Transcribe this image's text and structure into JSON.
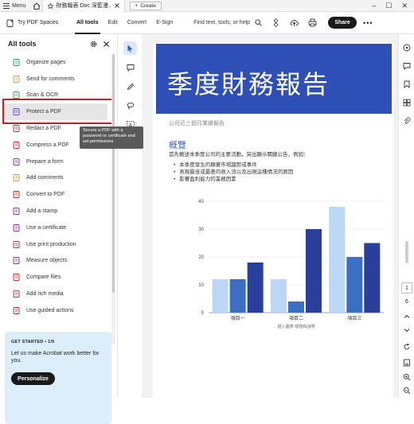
{
  "tabbar": {
    "menu_label": "Menu",
    "tab_title": "財務報表 Doc 深藍漫...",
    "create_label": "Create"
  },
  "toolbar": {
    "app_label": "Try PDF Spaces",
    "tabs": [
      {
        "label": "All tools",
        "active": true
      },
      {
        "label": "Edit"
      },
      {
        "label": "Convert"
      },
      {
        "label": "E-Sign"
      }
    ],
    "search_label": "Find text, tools, or help",
    "share_label": "Share"
  },
  "left_panel": {
    "title": "All tools",
    "tools": [
      {
        "label": "Organize pages",
        "icon": "organize-pages-icon",
        "color": "#38a169"
      },
      {
        "label": "Send for comments",
        "icon": "send-comments-icon",
        "color": "#d69e2e"
      },
      {
        "label": "Scan & OCR",
        "icon": "scan-ocr-icon",
        "color": "#38a169"
      },
      {
        "label": "Protect a PDF",
        "icon": "protect-pdf-icon",
        "color": "#6b46c1"
      },
      {
        "label": "Redact a PDF",
        "icon": "redact-pdf-icon",
        "color": "#c53030"
      },
      {
        "label": "Compress a PDF",
        "icon": "compress-pdf-icon",
        "color": "#c53030"
      },
      {
        "label": "Prepare a form",
        "icon": "prepare-form-icon",
        "color": "#9b2c9b"
      },
      {
        "label": "Add comments",
        "icon": "add-comments-icon",
        "color": "#d69e2e"
      },
      {
        "label": "Convert to PDF",
        "icon": "convert-pdf-icon",
        "color": "#c53030"
      },
      {
        "label": "Add a stamp",
        "icon": "stamp-icon",
        "color": "#9b2c9b"
      },
      {
        "label": "Use a certificate",
        "icon": "certificate-icon",
        "color": "#9b2c9b"
      },
      {
        "label": "Use print production",
        "icon": "print-production-icon",
        "color": "#c53030"
      },
      {
        "label": "Measure objects",
        "icon": "measure-icon",
        "color": "#9b2c9b"
      },
      {
        "label": "Compare files",
        "icon": "compare-files-icon",
        "color": "#c53030"
      },
      {
        "label": "Add rich media",
        "icon": "rich-media-icon",
        "color": "#c53030"
      },
      {
        "label": "Use guided actions",
        "icon": "guided-actions-icon",
        "color": "#c53030"
      }
    ],
    "tooltip": "Secure a PDF with a password or certificate and set permissions",
    "promo": {
      "label": "GET STARTED • 1/5",
      "text": "Let us make Acrobat work better for you.",
      "button": "Personalize"
    }
  },
  "document": {
    "banner_title": "季度財務報告",
    "subtitle": "公司近三個月業績報告",
    "section_heading": "概覽",
    "intro": "首先概述本季度公司的主要活動，突出顯示關鍵公告，例如：",
    "bullets": [
      "本季度發生的顯著市場趨勢或事件",
      "表現最佳或最差的收入流以及出現這種情況的原因",
      "影響盈利能力的業務因素"
    ]
  },
  "chart_data": {
    "type": "bar",
    "categories": [
      "項目一",
      "項目二",
      "項目三"
    ],
    "series": [
      {
        "values": [
          12,
          12,
          38
        ],
        "color": "#bcd7f5"
      },
      {
        "values": [
          12,
          4,
          20
        ],
        "color": "#3a6fc4"
      },
      {
        "values": [
          18,
          30,
          25
        ],
        "color": "#2a3f9c"
      }
    ],
    "ylim": [
      0,
      40
    ],
    "yticks": [
      0,
      10,
      20,
      30,
      40
    ],
    "caption": "插入圖表-標題和說明",
    "grid": true
  },
  "right_rail": {
    "page_number": "1",
    "page_count": "6"
  }
}
